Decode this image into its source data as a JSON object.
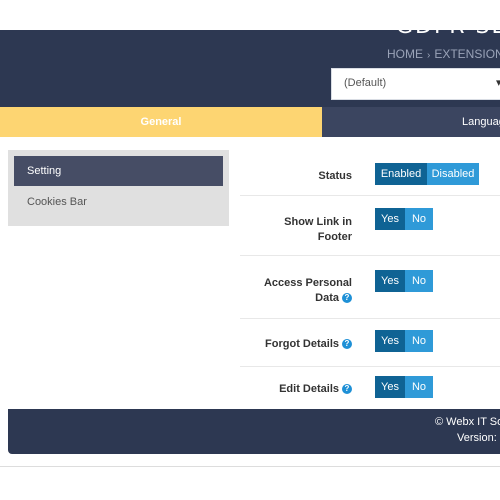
{
  "header": {
    "title": "GDPR SE",
    "breadcrumb": [
      "HOME",
      "EXTENSION"
    ],
    "store_select": "(Default)"
  },
  "tabs": [
    {
      "label": "General",
      "active": true
    },
    {
      "label": "Languag",
      "active": false
    }
  ],
  "sidebar": {
    "items": [
      {
        "label": "Setting",
        "active": true
      },
      {
        "label": "Cookies Bar",
        "active": false
      }
    ]
  },
  "settings": [
    {
      "label": "Status",
      "on_label": "Enabled",
      "off_label": "Disabled",
      "help": false
    },
    {
      "label_lines": [
        "Show Link in",
        "Footer"
      ],
      "on_label": "Yes",
      "off_label": "No",
      "help": false
    },
    {
      "label_lines": [
        "Access Personal",
        "Data"
      ],
      "on_label": "Yes",
      "off_label": "No",
      "help": true
    },
    {
      "label": "Forgot Details",
      "on_label": "Yes",
      "off_label": "No",
      "help": true
    },
    {
      "label": "Edit Details",
      "on_label": "Yes",
      "off_label": "No",
      "help": true
    }
  ],
  "help_glyph": "?",
  "footer": {
    "line1": "© Webx IT So",
    "line2": "Version:"
  },
  "colors": {
    "header_bg": "#2d3852",
    "tab_active": "#fdd572",
    "toggle_on": "#0f6394",
    "toggle_off": "#2f9ad8"
  }
}
